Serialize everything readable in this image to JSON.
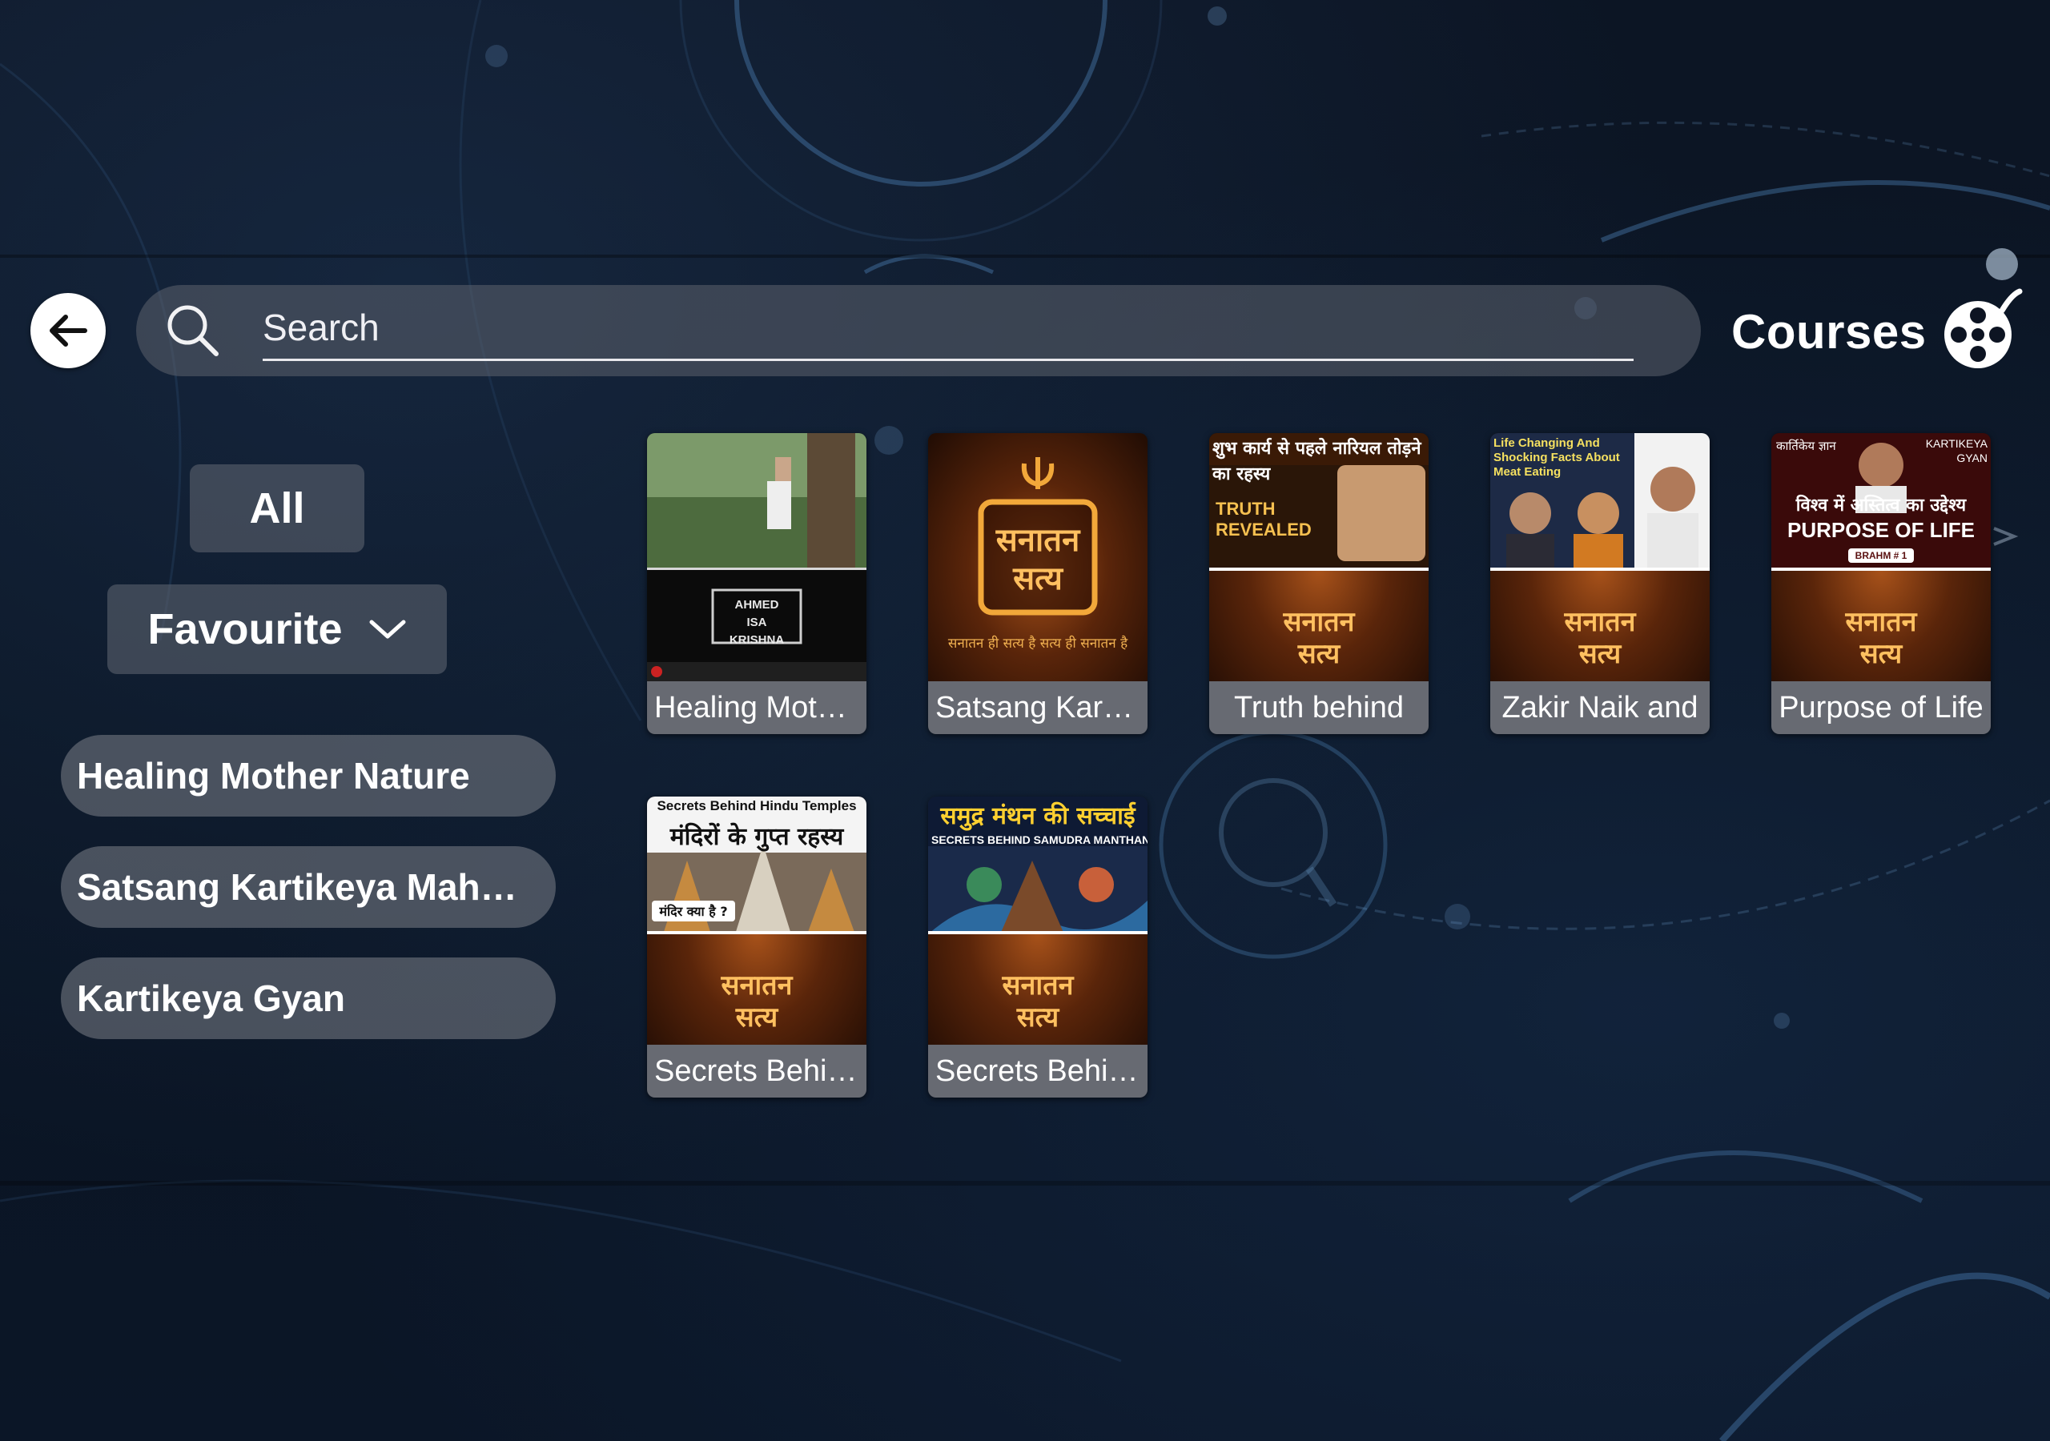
{
  "header": {
    "search_placeholder": "Search",
    "title": "Courses"
  },
  "filters": {
    "all_label": "All",
    "favourite_label": "Favourite"
  },
  "categories": [
    {
      "label": "Healing Mother Nature"
    },
    {
      "label": "Satsang Kartikeya Maharaj"
    },
    {
      "label": "Kartikeya Gyan"
    }
  ],
  "videos": [
    {
      "title": "Healing Mother Nature",
      "thumb_text": "AHMED ISA KRISHNA"
    },
    {
      "title": "Satsang Kartikeya",
      "thumb_text": "सनातन सत्य",
      "thumb_caption": "सनातन ही सत्य है सत्य ही सनातन है"
    },
    {
      "title": "Truth behind",
      "thumb_text": "शुभ कार्य से पहले नारियल तोड़ने का रहस्य",
      "thumb_caption": "TRUTH REVEALED"
    },
    {
      "title": "Zakir Naik and",
      "thumb_text": "Life Changing And Shocking Facts About Meat Eating"
    },
    {
      "title": "Purpose of Life",
      "thumb_text": "विश्व में अस्तित्व का उद्देश्य",
      "thumb_caption": "PURPOSE OF LIFE",
      "thumb_badge": "BRAHM # 1",
      "thumb_corner_left": "कार्तिकेय ज्ञान",
      "thumb_corner_right": "KARTIKEYA GYAN"
    },
    {
      "title": "Secrets Behind Hindu Temples",
      "thumb_text": "Secrets Behind Hindu Temples",
      "thumb_caption": "मंदिरों के गुप्त रहस्य",
      "thumb_badge": "मंदिर क्या है ?"
    },
    {
      "title": "Secrets Behind Samudra Manthan",
      "thumb_text": "समुद्र मंथन की सच्चाई",
      "thumb_caption": "SECRETS BEHIND SAMUDRA MANTHAN"
    }
  ],
  "brand_text": "सनातन सत्य",
  "colors": {
    "background": "#0b1220",
    "pill": "#5c626e",
    "card_label": "#787c86",
    "accent_orange": "#f0a030"
  }
}
